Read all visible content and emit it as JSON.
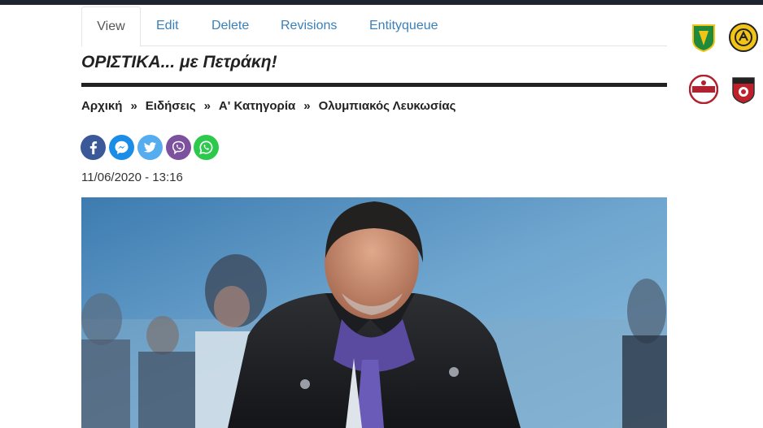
{
  "tabs": [
    {
      "label": "View"
    },
    {
      "label": "Edit"
    },
    {
      "label": "Delete"
    },
    {
      "label": "Revisions"
    },
    {
      "label": "Entityqueue"
    }
  ],
  "article": {
    "title": "ΟΡΙΣΤΙΚΑ... με Πετράκη!",
    "date": "11/06/2020 - 13:16"
  },
  "breadcrumb": {
    "separator": "»",
    "items": [
      {
        "label": "Αρχική"
      },
      {
        "label": "Ειδήσεις"
      },
      {
        "label": "Α' Κατηγορία"
      },
      {
        "label": "Ολυμπιακός Λευκωσίας"
      }
    ]
  },
  "share": [
    {
      "icon": "facebook-icon",
      "color": "#3b5998"
    },
    {
      "icon": "messenger-icon",
      "color": "#1c8de6"
    },
    {
      "icon": "twitter-icon",
      "color": "#55acee"
    },
    {
      "icon": "viber-icon",
      "color": "#7c529e"
    },
    {
      "icon": "whatsapp-icon",
      "color": "#2cc94d"
    }
  ],
  "sidebar_logos": [
    {
      "icon": "club-crest-green-icon"
    },
    {
      "icon": "club-crest-yellow-icon"
    },
    {
      "icon": "club-crest-enp-icon"
    },
    {
      "icon": "club-crest-red-icon"
    }
  ]
}
